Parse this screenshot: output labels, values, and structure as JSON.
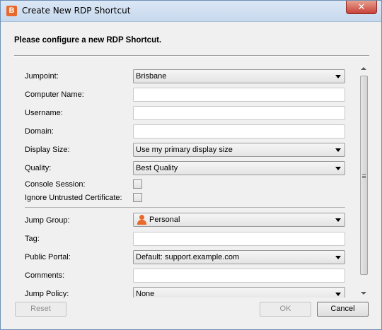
{
  "window": {
    "title": "Create New RDP Shortcut",
    "app_icon_letter": "B",
    "close_label": "✕"
  },
  "heading": "Please configure a new RDP Shortcut.",
  "fields": {
    "jumpoint": {
      "label": "Jumpoint:",
      "value": "Brisbane"
    },
    "computer_name": {
      "label": "Computer Name:",
      "value": ""
    },
    "username": {
      "label": "Username:",
      "value": ""
    },
    "domain": {
      "label": "Domain:",
      "value": ""
    },
    "display_size": {
      "label": "Display Size:",
      "value": "Use my primary display size"
    },
    "quality": {
      "label": "Quality:",
      "value": "Best Quality"
    },
    "console_session": {
      "label": "Console Session:",
      "checked": false
    },
    "ignore_untrusted": {
      "label": "Ignore Untrusted Certificate:",
      "checked": false
    },
    "jump_group": {
      "label": "Jump Group:",
      "value": "Personal",
      "icon": "person-icon"
    },
    "tag": {
      "label": "Tag:",
      "value": ""
    },
    "public_portal": {
      "label": "Public Portal:",
      "value": "Default: support.example.com"
    },
    "comments": {
      "label": "Comments:",
      "value": ""
    },
    "jump_policy": {
      "label": "Jump Policy:",
      "value": "None"
    }
  },
  "buttons": {
    "reset": "Reset",
    "ok": "OK",
    "cancel": "Cancel"
  }
}
